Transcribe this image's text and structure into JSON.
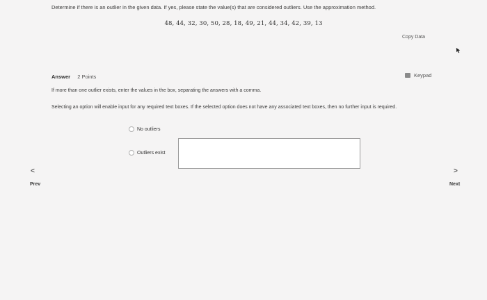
{
  "question": {
    "text": "Determine if there is an outlier in the given data. If yes, please state the value(s) that are considered outliers. Use the approximation method.",
    "dataset": "48, 44, 32, 30, 50, 28, 18, 49, 21, 44, 34, 42, 39, 13"
  },
  "copy_data_label": "Copy Data",
  "answer": {
    "label": "Answer",
    "points": "2 Points",
    "keypad_label": "Keypad",
    "instruction": "If more than one outlier exists, enter the values in the box, separating the answers with a comma.",
    "note": "Selecting an option will enable input for any required text boxes. If the selected option does not have any associated text boxes, then no further input is required.",
    "options": [
      {
        "label": "No outliers"
      },
      {
        "label": "Outliers exist"
      }
    ],
    "textbox_value": ""
  },
  "nav": {
    "prev_arrow": "<",
    "prev_label": "Prev",
    "next_arrow": ">",
    "next_label": "Next"
  },
  "icons": {
    "keypad": "keypad-icon",
    "cursor": "mouse-cursor-icon"
  }
}
